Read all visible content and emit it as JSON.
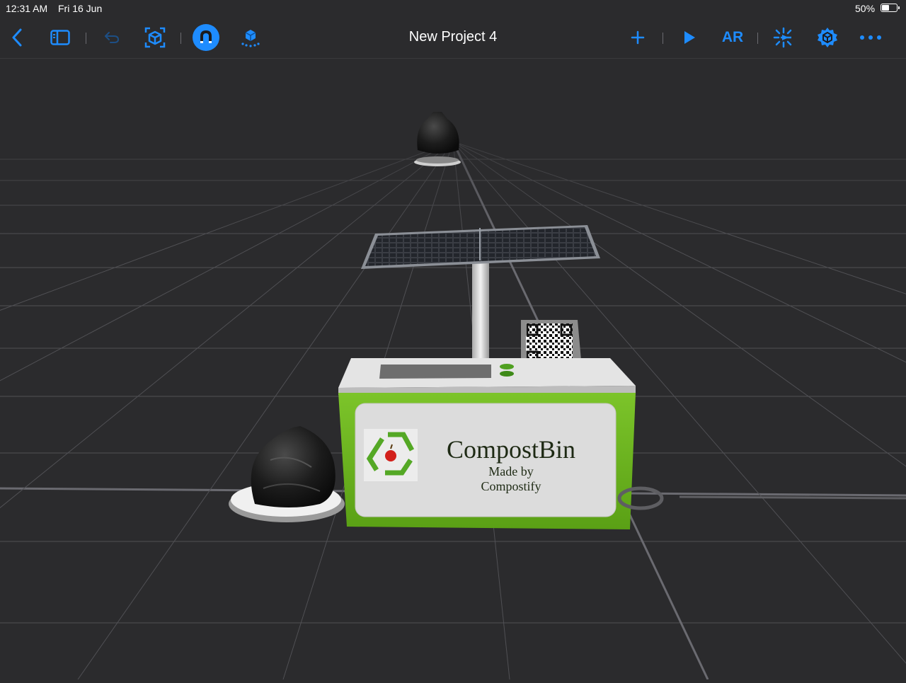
{
  "status": {
    "time": "12:31 AM",
    "date": "Fri 16 Jun",
    "battery": "50%",
    "battery_level": 0.5
  },
  "toolbar": {
    "title": "New Project 4",
    "ar_label": "AR",
    "accent": "#1e8cff",
    "icons": [
      "back-chevron-icon",
      "sidebar-icon",
      "undo-icon",
      "scene-objects-icon",
      "snap-magnet-icon",
      "scene-icon",
      "add-icon",
      "play-icon",
      "ar-icon",
      "behaviors-icon",
      "settings-gear-icon",
      "more-icon"
    ]
  },
  "model": {
    "brand": "CompostBin",
    "made_by": "Made by",
    "company": "Compostify",
    "colors": {
      "body": "#6cb51e",
      "panel": "#dcdcdc",
      "grid_bg": "#2b2b2d"
    }
  }
}
